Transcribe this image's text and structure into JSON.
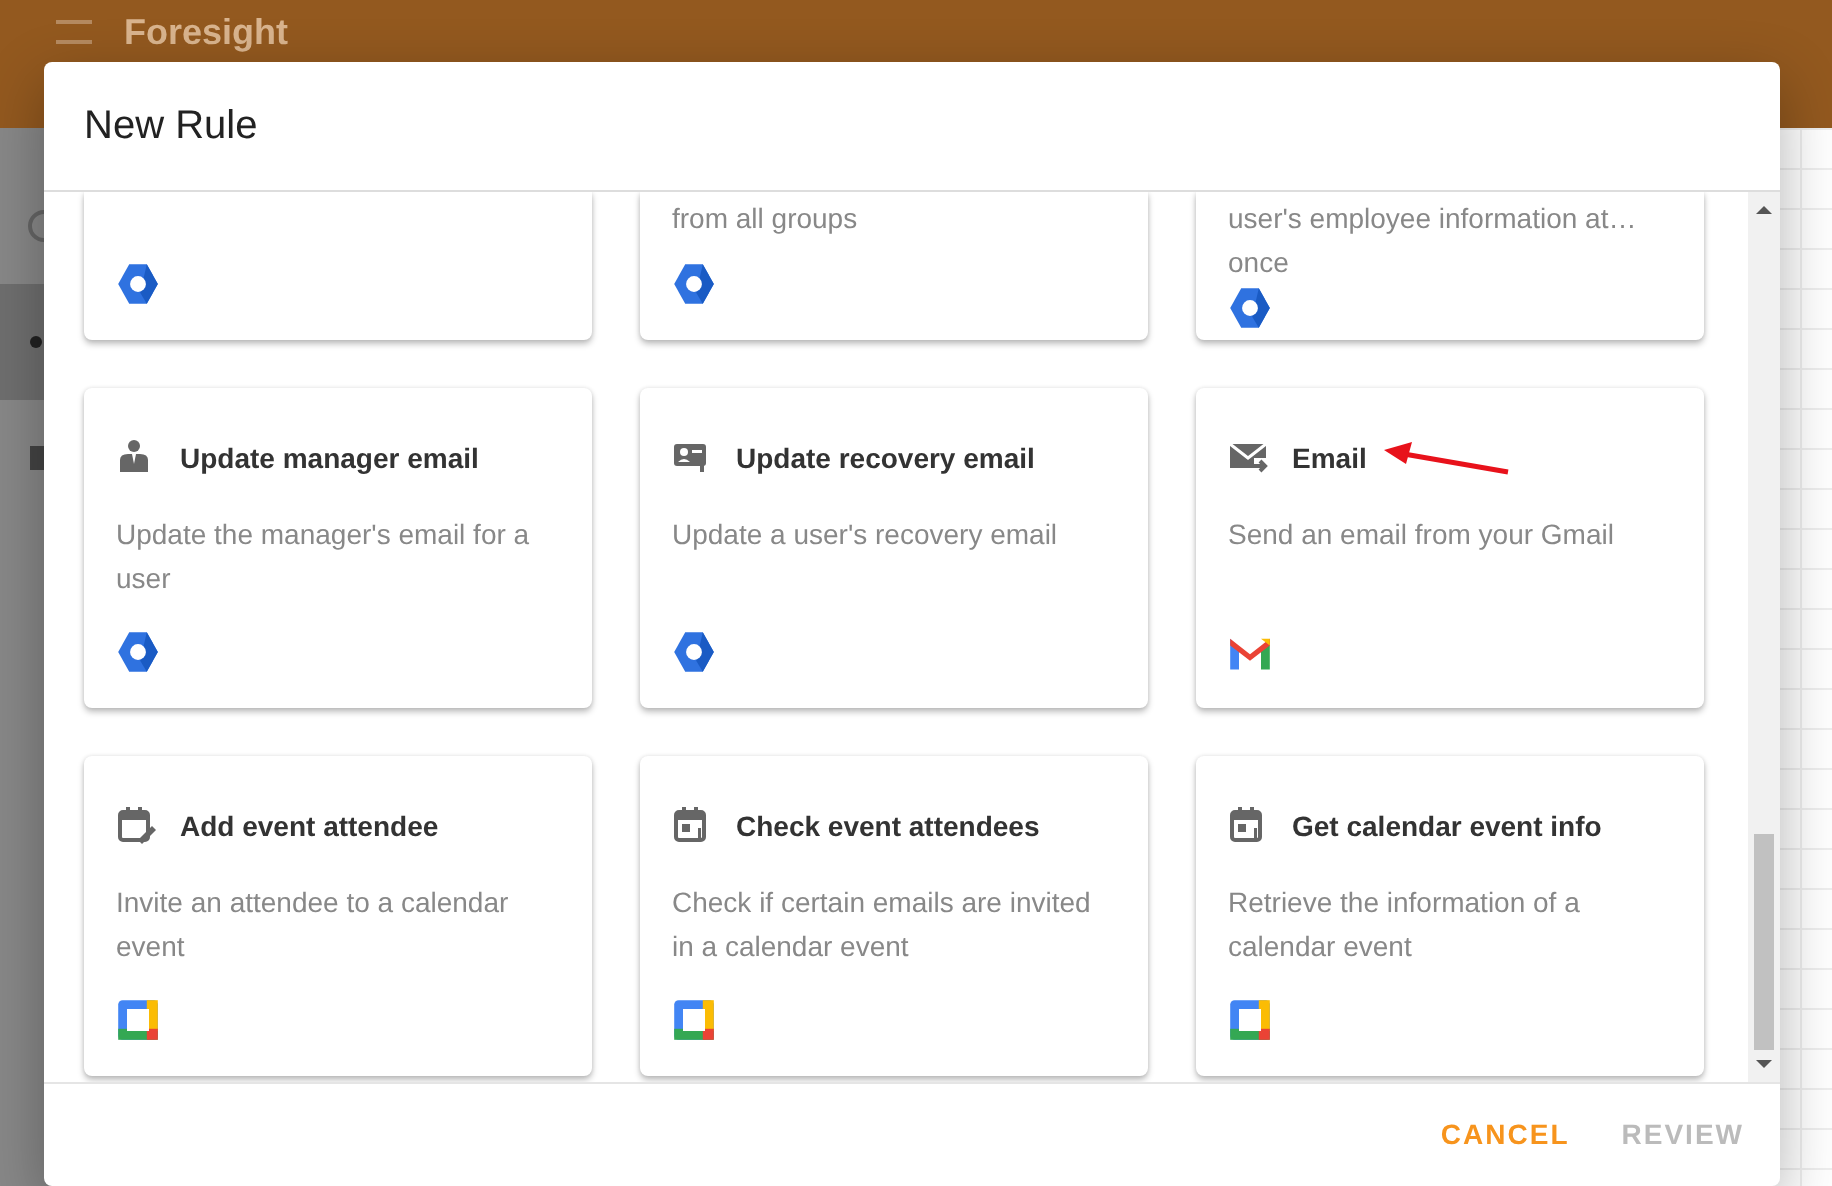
{
  "app_bar": {
    "title": "Foresight"
  },
  "dialog": {
    "title": "New Rule",
    "cards": [
      {
        "kind": "workspace"
      },
      {
        "kind": "workspace",
        "description_lines": [
          "from all groups"
        ]
      },
      {
        "kind": "workspace",
        "description_lines": [
          "user's employee information at…",
          "once"
        ]
      },
      {
        "kind": "workspace",
        "title": "Update manager email",
        "description_lines": [
          "Update the manager's email for a",
          "user"
        ]
      },
      {
        "kind": "workspace",
        "title": "Update recovery email",
        "description_lines": [
          "Update a user's recovery email"
        ]
      },
      {
        "kind": "gmail",
        "title": "Email",
        "description_lines": [
          "Send an email from your Gmail"
        ]
      },
      {
        "kind": "calendar",
        "title": "Add event attendee",
        "description_lines": [
          "Invite an attendee to a calendar",
          "event"
        ]
      },
      {
        "kind": "calendar",
        "title": "Check event attendees",
        "description_lines": [
          "Check if certain emails are invited",
          "in a calendar event"
        ]
      },
      {
        "kind": "calendar",
        "title": "Get calendar event info",
        "description_lines": [
          "Retrieve the information of a",
          "calendar event"
        ]
      }
    ],
    "buttons": [
      {
        "label": "CANCEL",
        "disabled": false
      },
      {
        "label": "REVIEW",
        "disabled": true
      }
    ]
  }
}
